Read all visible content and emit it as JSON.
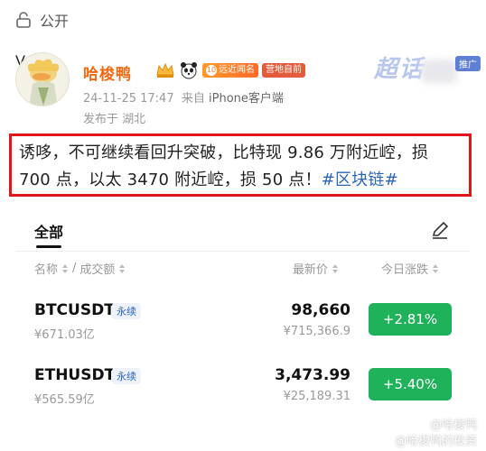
{
  "topbar": {
    "visibility_label": "公开",
    "icon": "unlock-icon"
  },
  "author": {
    "name": "哈梭鸭",
    "verified_icon": "verified-v-icon",
    "badges": {
      "crown_icon": "crown-icon",
      "panda_icon": "panda-icon",
      "fan_level": "10",
      "fan_label": "远近闻名",
      "ip_label": "营地自前"
    }
  },
  "meta": {
    "datetime": "24-11-25 17:47",
    "source_prefix": "来自",
    "device": "iPhone客户端",
    "location": "发布于 湖北"
  },
  "promo": {
    "brand_text": "超话",
    "ad_label": "推广"
  },
  "post": {
    "text": "诱哆，不可继续看回升突破，比特现 9.86 万附近崆，损 700 点，以太 3470 附近崆，损 50 点！",
    "hashtag": "#区块链#"
  },
  "market": {
    "tab_all": "全部",
    "edit_icon": "edit-pen-icon",
    "headers": {
      "name": "名称",
      "sep": "/",
      "volume": "成交额",
      "price": "最新价",
      "change": "今日涨跌"
    },
    "rows": [
      {
        "symbol": "BTCUSDT",
        "type": "永续",
        "volume": "¥671.03亿",
        "price": "98,660",
        "price_cny": "¥715,366.9",
        "change": "+2.81%"
      },
      {
        "symbol": "ETHUSDT",
        "type": "永续",
        "volume": "¥565.59亿",
        "price": "3,473.99",
        "price_cny": "¥25,189.31",
        "change": "+5.40%"
      }
    ],
    "up_color": "#20b25a"
  },
  "watermark": {
    "line1": "@哈梭鸭",
    "line2": "@哈梭鸭的投资"
  }
}
